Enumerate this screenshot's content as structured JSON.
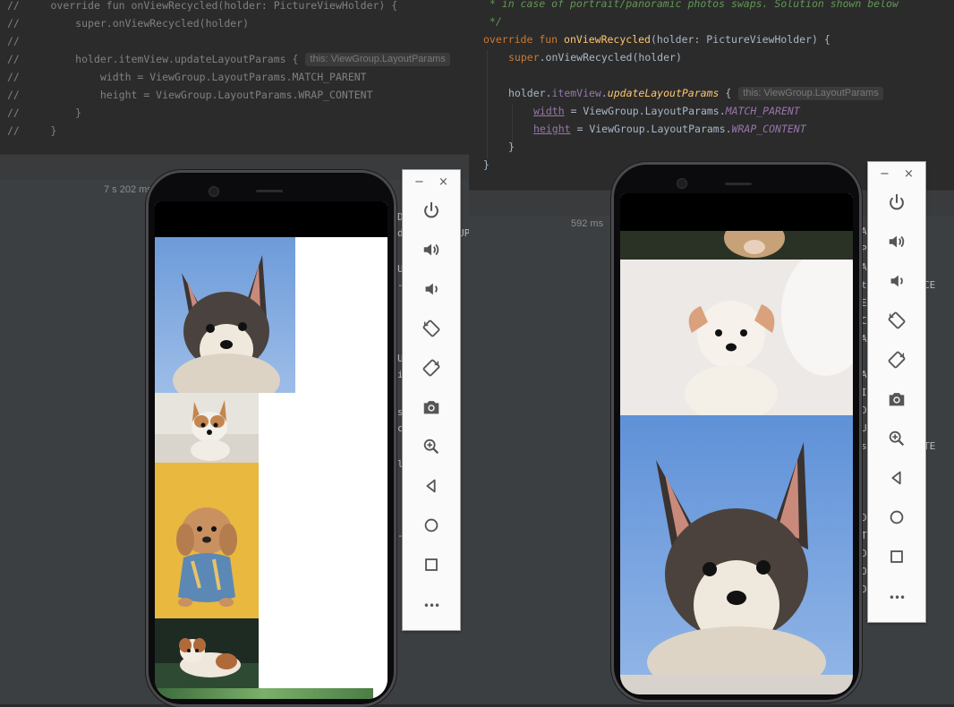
{
  "left_editor": {
    "lines": [
      {
        "prefix": "//",
        "indent": "    ",
        "text": "override fun onViewRecycled(holder: PictureViewHolder) {"
      },
      {
        "prefix": "//",
        "indent": "        ",
        "text": "super.onViewRecycled(holder)"
      },
      {
        "prefix": "//",
        "indent": "",
        "text": ""
      },
      {
        "prefix": "//",
        "indent": "        ",
        "text": "holder.itemView.updateLayoutParams {",
        "hint": "this: ViewGroup.LayoutParams"
      },
      {
        "prefix": "//",
        "indent": "            ",
        "text": "width = ViewGroup.LayoutParams.MATCH_PARENT"
      },
      {
        "prefix": "//",
        "indent": "            ",
        "text": "height = ViewGroup.LayoutParams.WRAP_CONTENT"
      },
      {
        "prefix": "//",
        "indent": "        ",
        "text": "}"
      },
      {
        "prefix": "//",
        "indent": "    ",
        "text": "}"
      }
    ],
    "timing": "7 s 202 ms",
    "log_fragments": [
      "D",
      "d",
      "UP",
      "U",
      "-",
      "U",
      "i",
      "s",
      "c",
      "l",
      "-"
    ]
  },
  "right_editor": {
    "doc_comment_1": " * in case of portrait/panoramic photos swaps. Solution shown below",
    "doc_comment_2": " */",
    "kw_override": "override",
    "kw_fun": "fun",
    "fn_name": "onViewRecycled",
    "signature_rest": "(holder: PictureViewHolder) {",
    "kw_super": "super",
    "super_call": ".onViewRecycled(holder)",
    "holder_ref": "holder.",
    "item_view": "itemView",
    "dot": ".",
    "update_fn": "updateLayoutParams",
    "brace_open": " {",
    "hint": "this: ViewGroup.LayoutParams",
    "prop_width": "width",
    "prop_height": "height",
    "assign_lp": " = ViewGroup.LayoutParams.",
    "const_match": "MATCH_PARENT",
    "const_wrap": "WRAP_CONTENT",
    "close_inner": "}",
    "close_outer": "}",
    "timing": "592 ms",
    "log_fragments": [
      "A",
      "P",
      "A",
      "t",
      "E",
      "C",
      "A",
      "A",
      "I",
      "D",
      "U",
      "s",
      "D",
      "T",
      "D",
      "O",
      "D"
    ],
    "log_tail_1": "CE",
    "log_tail_2": "TE"
  },
  "emulator_toolbar": {
    "minimize": "−",
    "close": "×",
    "buttons": [
      "power",
      "volume-up",
      "volume-down",
      "rotate-left",
      "rotate-right",
      "screenshot",
      "zoom",
      "back",
      "home",
      "overview",
      "more"
    ],
    "more_label": "•••"
  },
  "colors": {
    "editor_bg": "#2b2b2b",
    "comment": "#808080",
    "keyword": "#cc7832",
    "function": "#ffc66d",
    "property": "#9876aa",
    "doc_comment": "#629755",
    "plain_text": "#a9b7c6"
  }
}
